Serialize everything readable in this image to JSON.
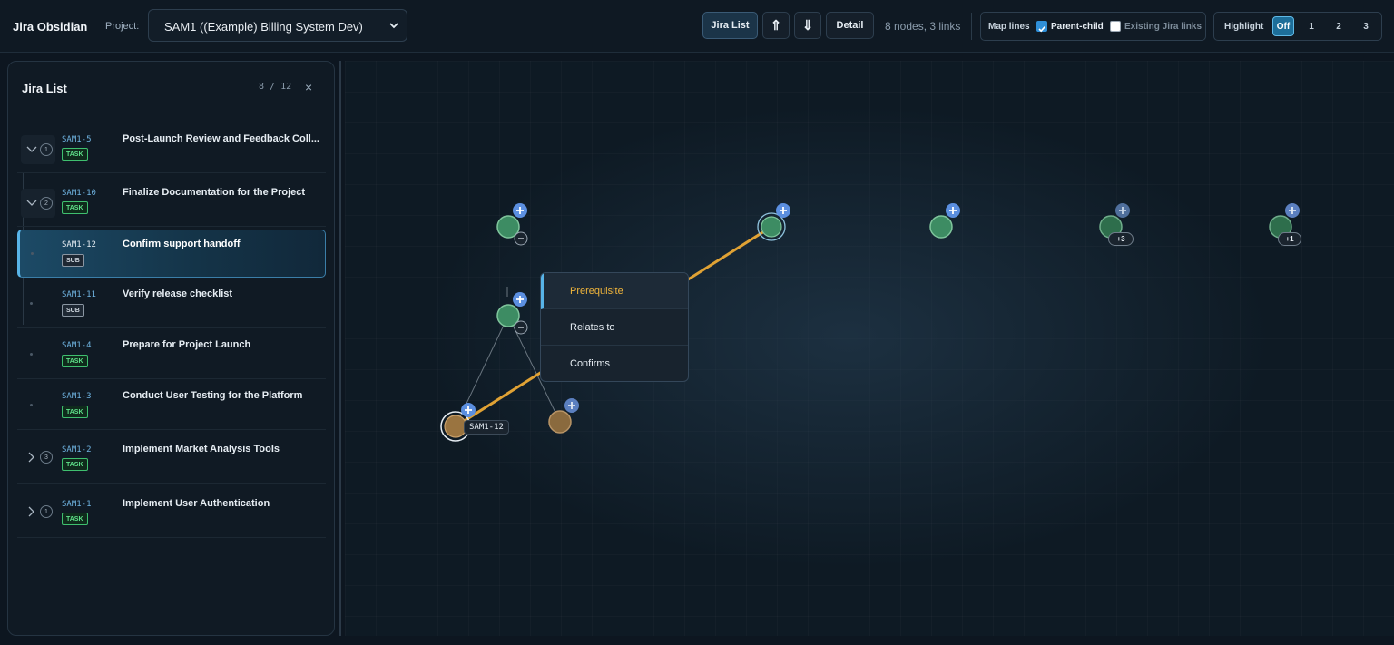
{
  "header": {
    "app_title": "Jira Obsidian",
    "project_label": "Project:",
    "project_value": "SAM1 ((Example) Billing System Dev)",
    "btn_jira_list": "Jira List",
    "btn_up": "⇑",
    "btn_down": "⇓",
    "btn_detail": "Detail",
    "stats": "8 nodes, 3 links",
    "map_lines_label": "Map lines",
    "parent_child_label": "Parent-child",
    "parent_child_checked": true,
    "existing_links_label": "Existing Jira links",
    "existing_links_checked": false,
    "highlight_label": "Highlight",
    "highlight_options": [
      "Off",
      "1",
      "2",
      "3"
    ],
    "highlight_selected": "Off"
  },
  "sidebar": {
    "title": "Jira List",
    "count": "8 / 12",
    "close": "×",
    "items": [
      {
        "key": "SAM1-5",
        "type": "TASK",
        "title": "Post-Launch Review and Feedback Coll...",
        "children": "1",
        "expanded": true
      },
      {
        "key": "SAM1-10",
        "type": "TASK",
        "title": "Finalize Documentation for the Project",
        "children": "2",
        "expanded": true
      },
      {
        "key": "SAM1-12",
        "type": "SUB",
        "title": "Confirm support handoff",
        "selected": true
      },
      {
        "key": "SAM1-11",
        "type": "SUB",
        "title": "Verify release checklist"
      },
      {
        "key": "SAM1-4",
        "type": "TASK",
        "title": "Prepare for Project Launch"
      },
      {
        "key": "SAM1-3",
        "type": "TASK",
        "title": "Conduct User Testing for the Platform"
      },
      {
        "key": "SAM1-2",
        "type": "TASK",
        "title": "Implement Market Analysis Tools",
        "children": "3",
        "expanded": false
      },
      {
        "key": "SAM1-1",
        "type": "TASK",
        "title": "Implement User Authentication",
        "children": "1",
        "expanded": false
      }
    ]
  },
  "graph": {
    "selected_label": "SAM1-12",
    "collapsed_counts": [
      "+3",
      "+1"
    ],
    "colors": {
      "task_node": "#3d8c63",
      "sub_node": "#9a7440",
      "link": "#e0a234",
      "add": "#5b8fe0"
    }
  },
  "context_menu": {
    "items": [
      "Prerequisite",
      "Relates to",
      "Confirms"
    ],
    "highlighted": "Prerequisite"
  }
}
